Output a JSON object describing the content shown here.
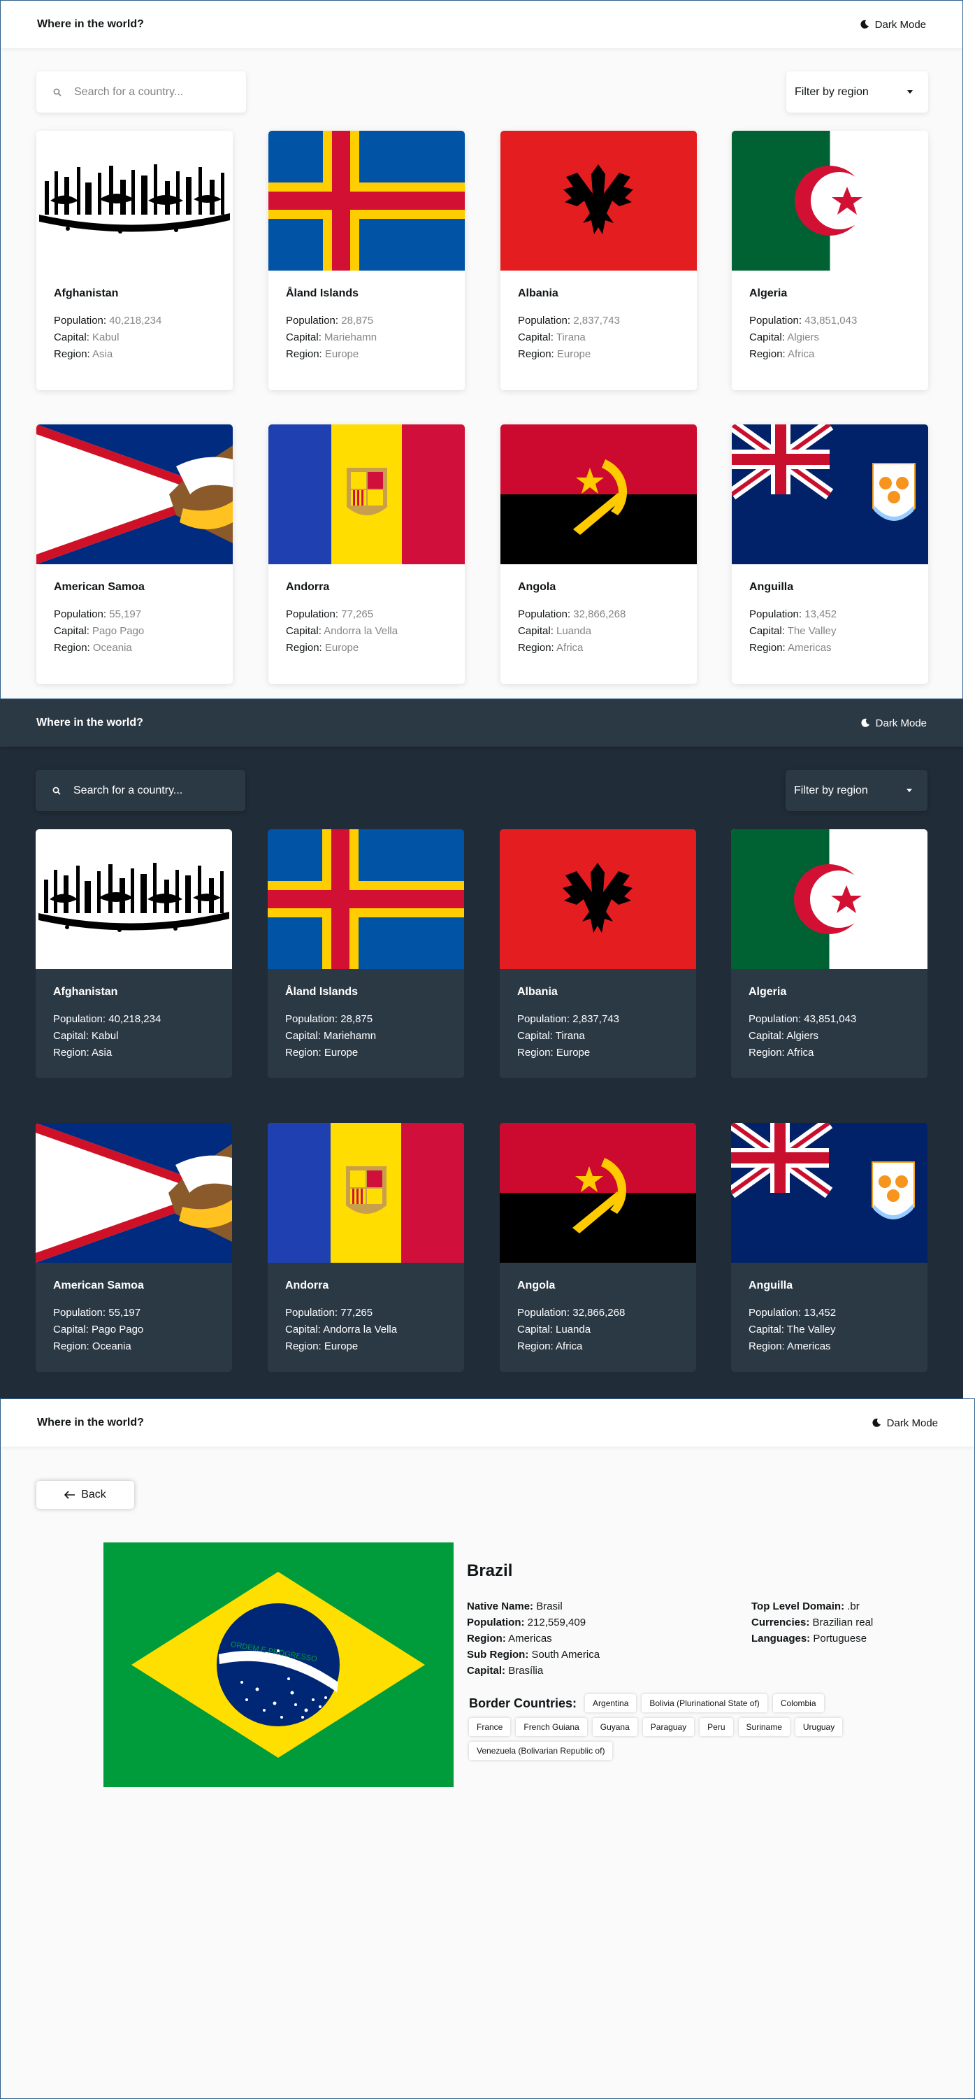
{
  "header": {
    "title": "Where in the world?",
    "mode_label": "Dark Mode"
  },
  "search": {
    "placeholder": "Search for a country..."
  },
  "filter": {
    "label": "Filter by region"
  },
  "labels": {
    "population": "Population:",
    "capital": "Capital:",
    "region": "Region:"
  },
  "countries": [
    {
      "name": "Afghanistan",
      "population": "40,218,234",
      "capital": "Kabul",
      "region": "Asia",
      "flag": "afghanistan-flag"
    },
    {
      "name": "Åland Islands",
      "population": "28,875",
      "capital": "Mariehamn",
      "region": "Europe",
      "flag": "aland-flag"
    },
    {
      "name": "Albania",
      "population": "2,837,743",
      "capital": "Tirana",
      "region": "Europe",
      "flag": "albania-flag"
    },
    {
      "name": "Algeria",
      "population": "43,851,043",
      "capital": "Algiers",
      "region": "Africa",
      "flag": "algeria-flag"
    },
    {
      "name": "American Samoa",
      "population": "55,197",
      "capital": "Pago Pago",
      "region": "Oceania",
      "flag": "american-samoa-flag"
    },
    {
      "name": "Andorra",
      "population": "77,265",
      "capital": "Andorra la Vella",
      "region": "Europe",
      "flag": "andorra-flag"
    },
    {
      "name": "Angola",
      "population": "32,866,268",
      "capital": "Luanda",
      "region": "Africa",
      "flag": "angola-flag"
    },
    {
      "name": "Anguilla",
      "population": "13,452",
      "capital": "The Valley",
      "region": "Americas",
      "flag": "anguilla-flag"
    }
  ],
  "detail": {
    "back_label": "Back",
    "name": "Brazil",
    "flag_motto": "ORDEM E PROGRESSO",
    "native_name_label": "Native Name:",
    "native_name": "Brasil",
    "population_label": "Population:",
    "population": "212,559,409",
    "region_label": "Region:",
    "region": "Americas",
    "sub_region_label": "Sub Region:",
    "sub_region": "South America",
    "capital_label": "Capital:",
    "capital": "Brasília",
    "tld_label": "Top Level Domain:",
    "tld": ".br",
    "currencies_label": "Currencies:",
    "currencies": "Brazilian real",
    "languages_label": "Languages:",
    "languages": "Portuguese",
    "border_label": "Border Countries:",
    "borders": [
      "Argentina",
      "Bolivia (Plurinational State of)",
      "Colombia",
      "France",
      "French Guiana",
      "Guyana",
      "Paraguay",
      "Peru",
      "Suriname",
      "Uruguay",
      "Venezuela (Bolivarian Republic of)"
    ]
  },
  "colors": {
    "light_bg": "#fafafa",
    "dark_bg": "#202c37",
    "dark_element": "#2b3945",
    "light_text": "#111517",
    "light_muted": "#858585"
  }
}
